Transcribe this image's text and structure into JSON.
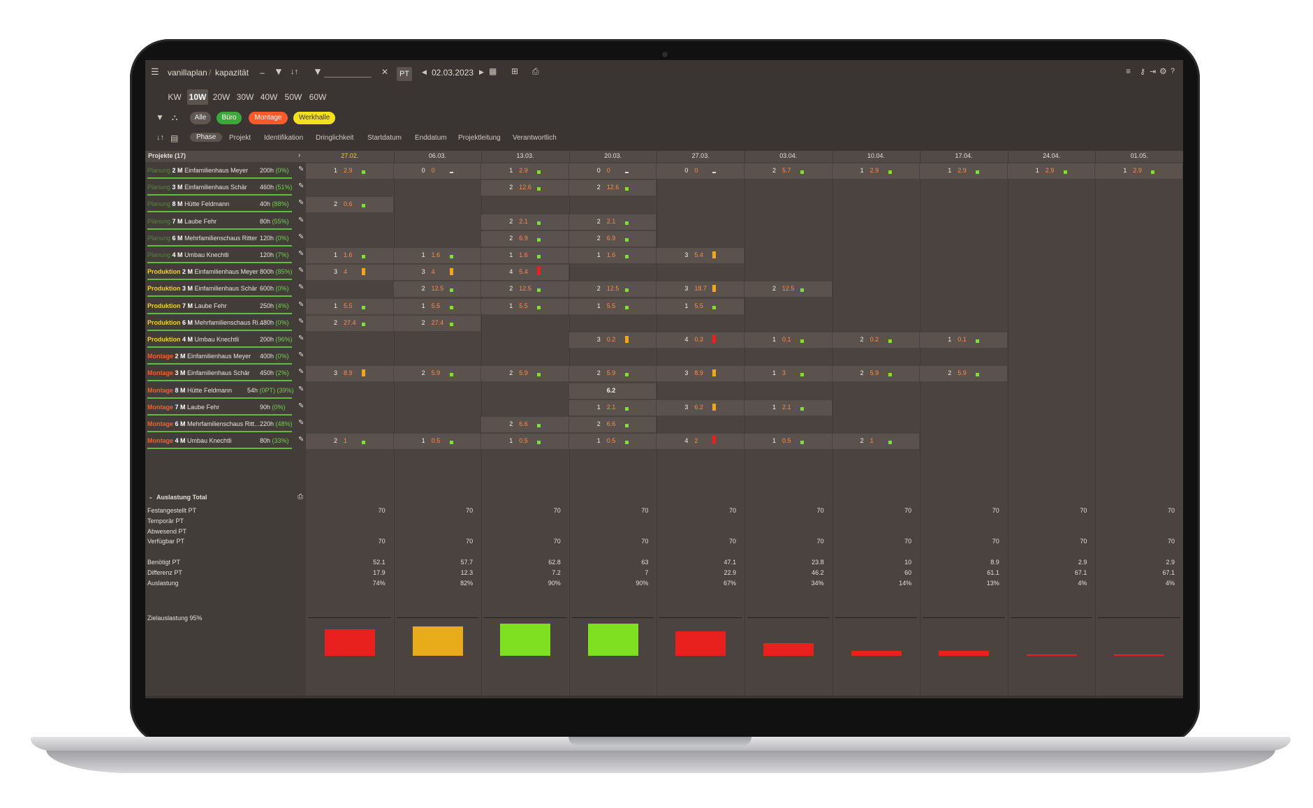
{
  "app": {
    "breadcrumb_app": "vanillaplan",
    "breadcrumb_sep": "/",
    "breadcrumb_page": "kapazität",
    "date": "02.03.2023",
    "unit_button": "PT",
    "sort_icon_label": "↓↑",
    "dash": "–"
  },
  "zoom": [
    "KW",
    "10W",
    "20W",
    "30W",
    "40W",
    "50W",
    "60W"
  ],
  "filters": {
    "all": "Alle",
    "buero": "Büro",
    "montage": "Montage",
    "werkhalle": "Werkhalle"
  },
  "sort_tabs": [
    "Phase",
    "Projekt",
    "Identifikation",
    "Dringlichkeit",
    "Startdatum",
    "Enddatum",
    "Projektleitung",
    "Verantwortlich"
  ],
  "header": {
    "projects_label": "Projekte (17)",
    "weeks": [
      "27.02.",
      "06.03.",
      "13.03.",
      "20.03.",
      "27.03.",
      "03.04.",
      "10.04.",
      "17.04.",
      "24.04.",
      "01.05."
    ]
  },
  "colors": {
    "planung": "#5fbf3a",
    "produktion": "#f2d21c",
    "montage": "#ff5a2a",
    "bar_green": "#7ee032",
    "bar_orange": "#f0a81a",
    "bar_red": "#e8201e"
  },
  "projects": [
    {
      "phase": "Planung",
      "ms": "2 M",
      "name": "Einfamilienhaus Meyer",
      "hours": "200h",
      "pct": "(0%)"
    },
    {
      "phase": "Planung",
      "ms": "3 M",
      "name": "Einfamilienhaus Schär",
      "hours": "460h",
      "pct": "(51%)"
    },
    {
      "phase": "Planung",
      "ms": "8 M",
      "name": "Hütte Feldmann",
      "hours": "40h",
      "pct": "(88%)"
    },
    {
      "phase": "Planung",
      "ms": "7 M",
      "name": "Laube Fehr",
      "hours": "80h",
      "pct": "(55%)"
    },
    {
      "phase": "Planung",
      "ms": "6 M",
      "name": "Mehrfamilienschaus Ritter",
      "hours": "120h",
      "pct": "(0%)"
    },
    {
      "phase": "Planung",
      "ms": "4 M",
      "name": "Umbau Knechtli",
      "hours": "120h",
      "pct": "(7%)"
    },
    {
      "phase": "Produktion",
      "ms": "2 M",
      "name": "Einfamilienhaus Meyer",
      "hours": "800h",
      "pct": "(85%)"
    },
    {
      "phase": "Produktion",
      "ms": "3 M",
      "name": "Einfamilienhaus Schär",
      "hours": "600h",
      "pct": "(0%)"
    },
    {
      "phase": "Produktion",
      "ms": "7 M",
      "name": "Laube Fehr",
      "hours": "250h",
      "pct": "(4%)"
    },
    {
      "phase": "Produktion",
      "ms": "6 M",
      "name": "Mehrfamilienschaus Ri...",
      "hours": "480h",
      "pct": "(0%)"
    },
    {
      "phase": "Produktion",
      "ms": "4 M",
      "name": "Umbau Knechtli",
      "hours": "200h",
      "pct": "(96%)"
    },
    {
      "phase": "Montage",
      "ms": "2 M",
      "name": "Einfamilienhaus Meyer",
      "hours": "400h",
      "pct": "(0%)"
    },
    {
      "phase": "Montage",
      "ms": "3 M",
      "name": "Einfamilienhaus Schär",
      "hours": "450h",
      "pct": "(2%)"
    },
    {
      "phase": "Montage",
      "ms": "8 M",
      "name": "Hütte Feldmann",
      "hours": "54h",
      "pct": "(0PT) (39%)"
    },
    {
      "phase": "Montage",
      "ms": "7 M",
      "name": "Laube Fehr",
      "hours": "90h",
      "pct": "(0%)"
    },
    {
      "phase": "Montage",
      "ms": "6 M",
      "name": "Mehrfamilienschaus Ritt...",
      "hours": "220h",
      "pct": "(48%)"
    },
    {
      "phase": "Montage",
      "ms": "4 M",
      "name": "Umbau Knechtli",
      "hours": "80h",
      "pct": "(33%)"
    }
  ],
  "cells": [
    {
      "r": 0,
      "c": 0,
      "a": "1",
      "b": "2.9",
      "bar": "g"
    },
    {
      "r": 0,
      "c": 1,
      "a": "0",
      "b": "0",
      "bar": "d"
    },
    {
      "r": 0,
      "c": 2,
      "a": "1",
      "b": "2.9",
      "bar": "g"
    },
    {
      "r": 0,
      "c": 3,
      "a": "0",
      "b": "0",
      "bar": "d"
    },
    {
      "r": 0,
      "c": 4,
      "a": "0",
      "b": "0",
      "bar": "d"
    },
    {
      "r": 0,
      "c": 5,
      "a": "2",
      "b": "5.7",
      "bar": "g"
    },
    {
      "r": 0,
      "c": 6,
      "a": "1",
      "b": "2.9",
      "bar": "g"
    },
    {
      "r": 0,
      "c": 7,
      "a": "1",
      "b": "2.9",
      "bar": "g"
    },
    {
      "r": 0,
      "c": 8,
      "a": "1",
      "b": "2.9",
      "bar": "g"
    },
    {
      "r": 0,
      "c": 9,
      "a": "1",
      "b": "2.9",
      "bar": "g"
    },
    {
      "r": 1,
      "c": 2,
      "a": "2",
      "b": "12.6",
      "bar": "g"
    },
    {
      "r": 1,
      "c": 3,
      "a": "2",
      "b": "12.6",
      "bar": "g"
    },
    {
      "r": 2,
      "c": 0,
      "a": "2",
      "b": "0.6",
      "bar": "g"
    },
    {
      "r": 3,
      "c": 2,
      "a": "2",
      "b": "2.1",
      "bar": "g"
    },
    {
      "r": 3,
      "c": 3,
      "a": "2",
      "b": "2.1",
      "bar": "g"
    },
    {
      "r": 4,
      "c": 2,
      "a": "2",
      "b": "6.9",
      "bar": "g"
    },
    {
      "r": 4,
      "c": 3,
      "a": "2",
      "b": "6.9",
      "bar": "g"
    },
    {
      "r": 5,
      "c": 0,
      "a": "1",
      "b": "1.6",
      "bar": "g"
    },
    {
      "r": 5,
      "c": 1,
      "a": "1",
      "b": "1.6",
      "bar": "g"
    },
    {
      "r": 5,
      "c": 2,
      "a": "1",
      "b": "1.6",
      "bar": "g"
    },
    {
      "r": 5,
      "c": 3,
      "a": "1",
      "b": "1.6",
      "bar": "g"
    },
    {
      "r": 5,
      "c": 4,
      "a": "3",
      "b": "5.4",
      "bar": "o"
    },
    {
      "r": 6,
      "c": 0,
      "a": "3",
      "b": "4",
      "bar": "o"
    },
    {
      "r": 6,
      "c": 1,
      "a": "3",
      "b": "4",
      "bar": "o"
    },
    {
      "r": 6,
      "c": 2,
      "a": "4",
      "b": "5.4",
      "bar": "r"
    },
    {
      "r": 7,
      "c": 1,
      "a": "2",
      "b": "12.5",
      "bar": "g"
    },
    {
      "r": 7,
      "c": 2,
      "a": "2",
      "b": "12.5",
      "bar": "g"
    },
    {
      "r": 7,
      "c": 3,
      "a": "2",
      "b": "12.5",
      "bar": "g"
    },
    {
      "r": 7,
      "c": 4,
      "a": "3",
      "b": "18.7",
      "bar": "o"
    },
    {
      "r": 7,
      "c": 5,
      "a": "2",
      "b": "12.5",
      "bar": "g"
    },
    {
      "r": 8,
      "c": 0,
      "a": "1",
      "b": "5.5",
      "bar": "g"
    },
    {
      "r": 8,
      "c": 1,
      "a": "1",
      "b": "5.5",
      "bar": "g"
    },
    {
      "r": 8,
      "c": 2,
      "a": "1",
      "b": "5.5",
      "bar": "g"
    },
    {
      "r": 8,
      "c": 3,
      "a": "1",
      "b": "5.5",
      "bar": "g"
    },
    {
      "r": 8,
      "c": 4,
      "a": "1",
      "b": "5.5",
      "bar": "g"
    },
    {
      "r": 9,
      "c": 0,
      "a": "2",
      "b": "27.4",
      "bar": "g"
    },
    {
      "r": 9,
      "c": 1,
      "a": "2",
      "b": "27.4",
      "bar": "g"
    },
    {
      "r": 10,
      "c": 3,
      "a": "3",
      "b": "0.2",
      "bar": "o"
    },
    {
      "r": 10,
      "c": 4,
      "a": "4",
      "b": "0.3",
      "bar": "r"
    },
    {
      "r": 10,
      "c": 5,
      "a": "1",
      "b": "0.1",
      "bar": "g"
    },
    {
      "r": 10,
      "c": 6,
      "a": "2",
      "b": "0.2",
      "bar": "g"
    },
    {
      "r": 10,
      "c": 7,
      "a": "1",
      "b": "0.1",
      "bar": "g"
    },
    {
      "r": 12,
      "c": 0,
      "a": "3",
      "b": "8.9",
      "bar": "o"
    },
    {
      "r": 12,
      "c": 1,
      "a": "2",
      "b": "5.9",
      "bar": "g"
    },
    {
      "r": 12,
      "c": 2,
      "a": "2",
      "b": "5.9",
      "bar": "g"
    },
    {
      "r": 12,
      "c": 3,
      "a": "2",
      "b": "5.9",
      "bar": "g"
    },
    {
      "r": 12,
      "c": 4,
      "a": "3",
      "b": "8.9",
      "bar": "o"
    },
    {
      "r": 12,
      "c": 5,
      "a": "1",
      "b": "3",
      "bar": "g"
    },
    {
      "r": 12,
      "c": 6,
      "a": "2",
      "b": "5.9",
      "bar": "g"
    },
    {
      "r": 12,
      "c": 7,
      "a": "2",
      "b": "5.9",
      "bar": "g"
    },
    {
      "r": 13,
      "c": 3,
      "a": "",
      "b": "6.2",
      "bar": "none"
    },
    {
      "r": 14,
      "c": 3,
      "a": "1",
      "b": "2.1",
      "bar": "g"
    },
    {
      "r": 14,
      "c": 4,
      "a": "3",
      "b": "6.2",
      "bar": "o"
    },
    {
      "r": 14,
      "c": 5,
      "a": "1",
      "b": "2.1",
      "bar": "g"
    },
    {
      "r": 15,
      "c": 2,
      "a": "2",
      "b": "6.6",
      "bar": "g"
    },
    {
      "r": 15,
      "c": 3,
      "a": "2",
      "b": "6.6",
      "bar": "g"
    },
    {
      "r": 16,
      "c": 0,
      "a": "2",
      "b": "1",
      "bar": "g"
    },
    {
      "r": 16,
      "c": 1,
      "a": "1",
      "b": "0.5",
      "bar": "g"
    },
    {
      "r": 16,
      "c": 2,
      "a": "1",
      "b": "0.5",
      "bar": "g"
    },
    {
      "r": 16,
      "c": 3,
      "a": "1",
      "b": "0.5",
      "bar": "g"
    },
    {
      "r": 16,
      "c": 4,
      "a": "4",
      "b": "2",
      "bar": "r"
    },
    {
      "r": 16,
      "c": 5,
      "a": "1",
      "b": "0.5",
      "bar": "g"
    },
    {
      "r": 16,
      "c": 6,
      "a": "2",
      "b": "1",
      "bar": "g"
    }
  ],
  "summary": {
    "title": "Auslastung Total",
    "rows": [
      {
        "label": "Festangestellt PT",
        "values": [
          "70",
          "70",
          "70",
          "70",
          "70",
          "70",
          "70",
          "70",
          "70",
          "70"
        ]
      },
      {
        "label": "Temporär PT",
        "values": [
          "",
          "",
          "",
          "",
          "",
          "",
          "",
          "",
          "",
          ""
        ]
      },
      {
        "label": "Abwesend PT",
        "values": [
          "",
          "",
          "",
          "",
          "",
          "",
          "",
          "",
          "",
          ""
        ]
      },
      {
        "label": "Verfügbar PT",
        "values": [
          "70",
          "70",
          "70",
          "70",
          "70",
          "70",
          "70",
          "70",
          "70",
          "70"
        ]
      },
      {
        "label": "Benötigt PT",
        "values": [
          "52.1",
          "57.7",
          "62.8",
          "63",
          "47.1",
          "23.8",
          "10",
          "8.9",
          "2.9",
          "2.9"
        ]
      },
      {
        "label": "Differenz PT",
        "values": [
          "17.9",
          "12.3",
          "7.2",
          "7",
          "22.9",
          "46.2",
          "60",
          "61.1",
          "67.1",
          "67.1"
        ]
      },
      {
        "label": "Auslastung",
        "values": [
          "74%",
          "82%",
          "90%",
          "90%",
          "67%",
          "34%",
          "14%",
          "13%",
          "4%",
          "4%"
        ]
      }
    ],
    "goal_label": "Zielauslastung 95%"
  },
  "chart_data": {
    "type": "bar",
    "categories": [
      "27.02.",
      "06.03.",
      "13.03.",
      "20.03.",
      "27.03.",
      "03.04.",
      "10.04.",
      "17.04.",
      "24.04.",
      "01.05."
    ],
    "values": [
      74,
      82,
      90,
      90,
      67,
      34,
      14,
      13,
      4,
      4
    ],
    "colors": [
      "#e8201e",
      "#e8ac1a",
      "#7ee020",
      "#7ee020",
      "#e8201e",
      "#e8201e",
      "#e8201e",
      "#e8201e",
      "#e8201e",
      "#e8201e"
    ],
    "target": 95,
    "title": "Zielauslastung 95%",
    "ylim": [
      0,
      95
    ]
  }
}
